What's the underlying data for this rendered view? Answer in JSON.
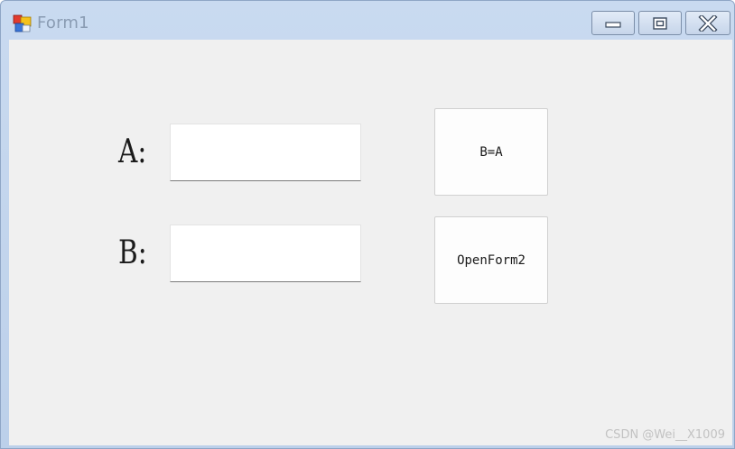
{
  "window": {
    "title": "Form1",
    "app_icon": "winforms-app-icon",
    "controls": {
      "minimize_icon": "minimize-icon",
      "maximize_icon": "maximize-icon",
      "close_icon": "close-icon"
    }
  },
  "form": {
    "label_a": "A:",
    "label_b": "B:",
    "textbox_a_value": "",
    "textbox_b_value": "",
    "button_b_equals_a": "B=A",
    "button_open_form2": "OpenForm2"
  },
  "watermark": "CSDN @Wei__X1009",
  "colors": {
    "client_background": "#f0f0f0",
    "titlebar": "#c9daf0",
    "title_text": "#8a9cb3"
  }
}
